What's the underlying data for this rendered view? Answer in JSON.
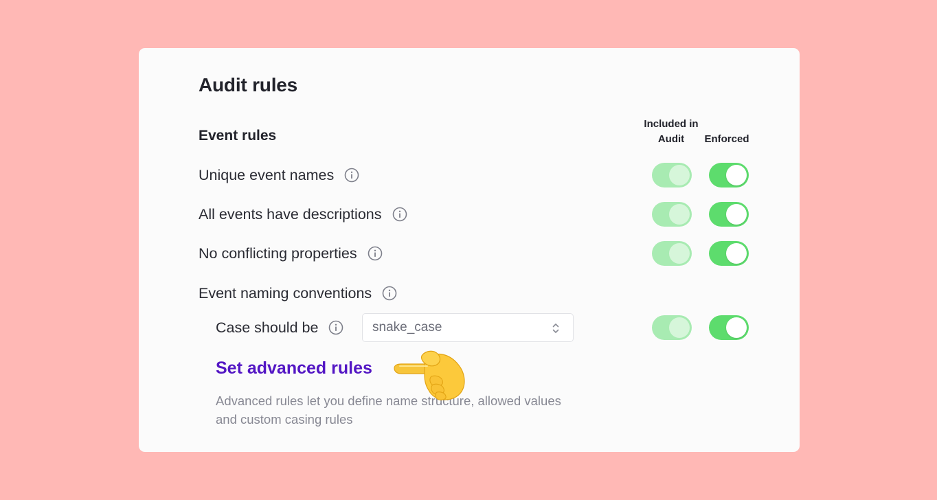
{
  "title": "Audit rules",
  "section_title": "Event rules",
  "columns": {
    "included": "Included in Audit",
    "enforced": "Enforced"
  },
  "rules": [
    {
      "label": "Unique event names",
      "included": true,
      "enforced": true
    },
    {
      "label": "All events have descriptions",
      "included": true,
      "enforced": true
    },
    {
      "label": "No conflicting properties",
      "included": true,
      "enforced": true
    },
    {
      "label": "Event naming conventions"
    }
  ],
  "case_rule": {
    "label": "Case should be",
    "value": "snake_case",
    "included": true,
    "enforced": true
  },
  "advanced": {
    "link": "Set advanced rules",
    "help": "Advanced rules let you define name structure, allowed values and custom casing rules"
  },
  "icons": {
    "info": "info-circle-icon",
    "chevron": "chevron-up-down-icon",
    "pointer": "pointing-hand-emoji"
  },
  "colors": {
    "background": "#ffb8b5",
    "card": "#fbfbfb",
    "toggle_enforced": "#5ddc6d",
    "toggle_included": "#a8ebb2",
    "link": "#5316c4"
  }
}
